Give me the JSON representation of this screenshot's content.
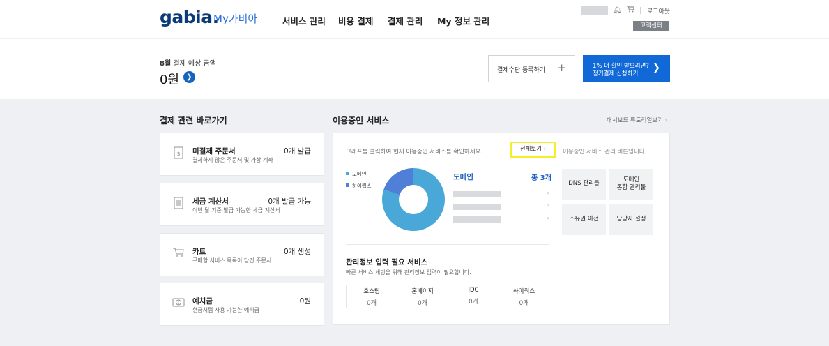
{
  "header": {
    "logo": "gabia.",
    "brand": "My가비아",
    "nav": [
      "서비스 관리",
      "비용 결제",
      "결제 관리",
      "My 정보 관리"
    ],
    "logout": "로그아웃",
    "customer_center": "고객센터"
  },
  "summary": {
    "label_month": "8월",
    "label_rest": " 결제 예상 금액",
    "amount": "0원",
    "pay_method_button": "결제수단 등록하기",
    "discount_line1": "1% 더 할인 받으려면?",
    "discount_line2": "정기결제 신청하기"
  },
  "shortcuts": {
    "title": "결제 관련 바로가기",
    "cards": [
      {
        "title": "미결제 주문서",
        "count": "0개 발급",
        "sub": "결제하지 않은 주문서 및 가상 계좌"
      },
      {
        "title": "세금 계산서",
        "count": "0개 발급 가능",
        "sub": "이번 달 기준 발급 가능한 세금 계산서"
      },
      {
        "title": "카트",
        "count": "0개 생성",
        "sub": "구매할 서비스 목록이 담긴 주문서"
      },
      {
        "title": "예치금",
        "count": "0원",
        "sub": "현금처럼 사용 가능한 예치금"
      }
    ]
  },
  "services": {
    "title": "이용중인 서비스",
    "tutorial": "대시보드 튜토리얼보기",
    "hint": "그래프를 클릭하여 현재 이용중인 서비스를 확인하세요.",
    "view_all": "전체보기",
    "manage_hint": "이용중인 서비스 관리 버튼입니다.",
    "legend": [
      {
        "label": "도메인",
        "color": "#4aa8d8"
      },
      {
        "label": "하이웍스",
        "color": "#4f7fd6"
      }
    ],
    "donut": [
      {
        "name": "도메인",
        "value": 0.8,
        "color": "#4aa8d8"
      },
      {
        "name": "하이웍스",
        "value": 0.2,
        "color": "#4f7fd6"
      }
    ],
    "domain_title": "도메인",
    "domain_total": "총 3개",
    "manage_buttons": [
      "DNS 관리툴",
      "도메인\n통합 관리툴",
      "소유권 이전",
      "담당자 설정"
    ],
    "required_title": "관리정보 입력 필요 서비스",
    "required_sub": "빠른 서비스 세팅을 위해 관리정보 입력이 필요합니다.",
    "required": [
      {
        "label": "호스팅",
        "value": "0개"
      },
      {
        "label": "홈페이지",
        "value": "0개"
      },
      {
        "label": "IDC",
        "value": "0개"
      },
      {
        "label": "하이웍스",
        "value": "0개"
      }
    ]
  }
}
